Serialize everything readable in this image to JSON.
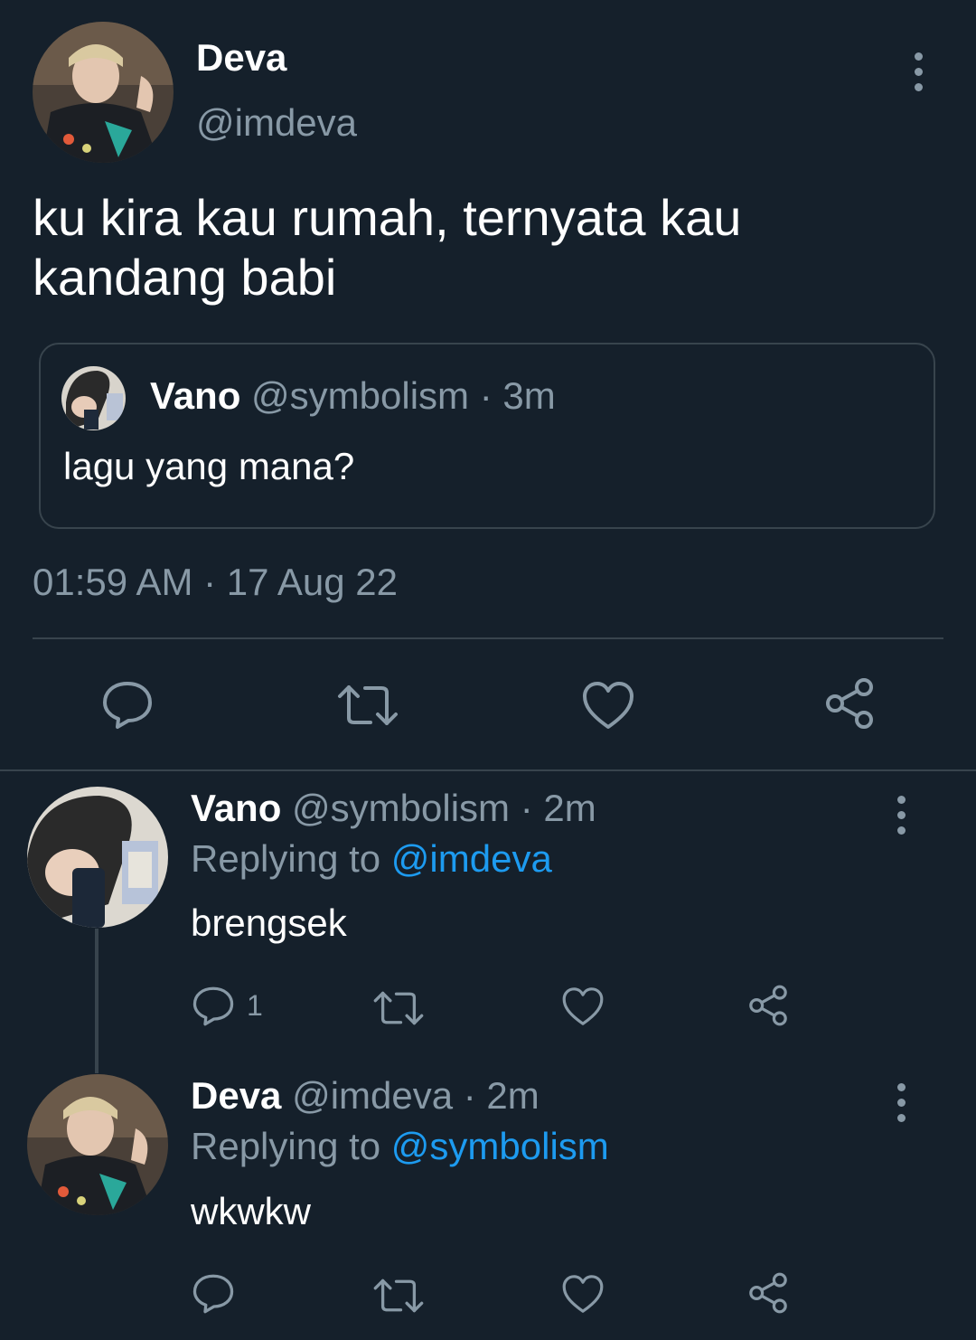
{
  "tweet": {
    "author_name": "Deva",
    "author_handle": "@imdeva",
    "text": "ku kira kau rumah, ternyata kau kandang babi",
    "timestamp": "01:59 AM · 17 Aug 22",
    "quoted": {
      "name": "Vano",
      "handle_time": "@symbolism · 3m",
      "text": "lagu yang mana?"
    }
  },
  "replies": [
    {
      "name": "Vano",
      "handle_time": "@symbolism · 2m",
      "replying_prefix": "Replying to",
      "replying_to": "@imdeva",
      "text": "brengsek",
      "reply_count": "1"
    },
    {
      "name": "Deva",
      "handle_time": "@imdeva · 2m",
      "replying_prefix": "Replying to",
      "replying_to": "@symbolism",
      "text": "wkwkw",
      "reply_count": ""
    }
  ],
  "colors": {
    "background": "#15202b",
    "muted": "#8899a6",
    "link": "#1d9bf0",
    "divider": "#38444d"
  },
  "icons": [
    "more-vertical-icon",
    "reply-icon",
    "retweet-icon",
    "like-icon",
    "share-icon"
  ]
}
